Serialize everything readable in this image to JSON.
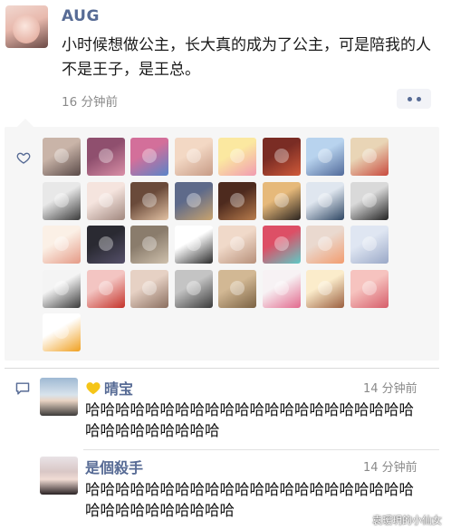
{
  "post": {
    "author": "AUG",
    "text": "小时候想做公主，长大真的成为了公主，可是陪我的人不是王子，是王总。",
    "time": "16 分钟前"
  },
  "likes": {
    "avatars": [
      {
        "c1": "#c9b4a8",
        "c2": "#5a4a48"
      },
      {
        "c1": "#8f4f6e",
        "c2": "#d98fa7"
      },
      {
        "c1": "#d36f9a",
        "c2": "#5a84c8"
      },
      {
        "c1": "#f3d8c4",
        "c2": "#c79b86"
      },
      {
        "c1": "#fbe8a0",
        "c2": "#f19bb1"
      },
      {
        "c1": "#7a2c24",
        "c2": "#d05a3a"
      },
      {
        "c1": "#b8d3ee",
        "c2": "#516a9a"
      },
      {
        "c1": "#e9d5b6",
        "c2": "#c84a3e"
      },
      {
        "c1": "#e8e8e8",
        "c2": "#3a3a3a"
      },
      {
        "c1": "#f5e4de",
        "c2": "#a0877e"
      },
      {
        "c1": "#6a4a3a",
        "c2": "#e3c2a4"
      },
      {
        "c1": "#5e6a8a",
        "c2": "#c9a36e"
      },
      {
        "c1": "#4d2a1e",
        "c2": "#b87c4c"
      },
      {
        "c1": "#e6b97a",
        "c2": "#2b2420"
      },
      {
        "c1": "#dfe6ef",
        "c2": "#2e4663"
      },
      {
        "c1": "#d9d9d9",
        "c2": "#222222"
      },
      {
        "c1": "#fbf0e6",
        "c2": "#e59a86"
      },
      {
        "c1": "#2a2a32",
        "c2": "#55506a"
      },
      {
        "c1": "#8a7c6c",
        "c2": "#cfc1ad"
      },
      {
        "c1": "#ffffff",
        "c2": "#2b2b2b"
      },
      {
        "c1": "#f0d9c9",
        "c2": "#b7907a"
      },
      {
        "c1": "#dd4f66",
        "c2": "#5ecac6"
      },
      {
        "c1": "#ead9cf",
        "c2": "#f29c6f"
      },
      {
        "c1": "#dfe6f2",
        "c2": "#9aa8c7"
      },
      {
        "c1": "#f4f4f4",
        "c2": "#3a3a3a"
      },
      {
        "c1": "#f3c5c2",
        "c2": "#c4332a"
      },
      {
        "c1": "#e6d1c4",
        "c2": "#8a6e5f"
      },
      {
        "c1": "#c4c4c4",
        "c2": "#3a3a3a"
      },
      {
        "c1": "#d2b894",
        "c2": "#7b6243"
      },
      {
        "c1": "#f7f2f4",
        "c2": "#e26a8e"
      },
      {
        "c1": "#fbeccb",
        "c2": "#9b5f3f"
      },
      {
        "c1": "#f6c3bf",
        "c2": "#d65d6a"
      },
      {
        "c1": "#ffffff",
        "c2": "#f0a020"
      }
    ]
  },
  "comments": [
    {
      "name": "晴宝",
      "time": "14 分钟前",
      "text": "哈哈哈哈哈哈哈哈哈哈哈哈哈哈哈哈哈哈哈哈哈哈哈哈哈哈哈哈哈哈哈"
    },
    {
      "name": "是個殺手",
      "time": "14 分钟前",
      "text": "哈哈哈哈哈哈哈哈哈哈哈哈哈哈哈哈哈哈哈哈哈哈哈哈哈哈哈哈哈哈哈哈"
    }
  ],
  "watermark": "袁瑷玥的小仙女",
  "colors": {
    "link": "#576b95",
    "time": "#8a8a8a",
    "likes_bg": "#f6f6f6"
  }
}
